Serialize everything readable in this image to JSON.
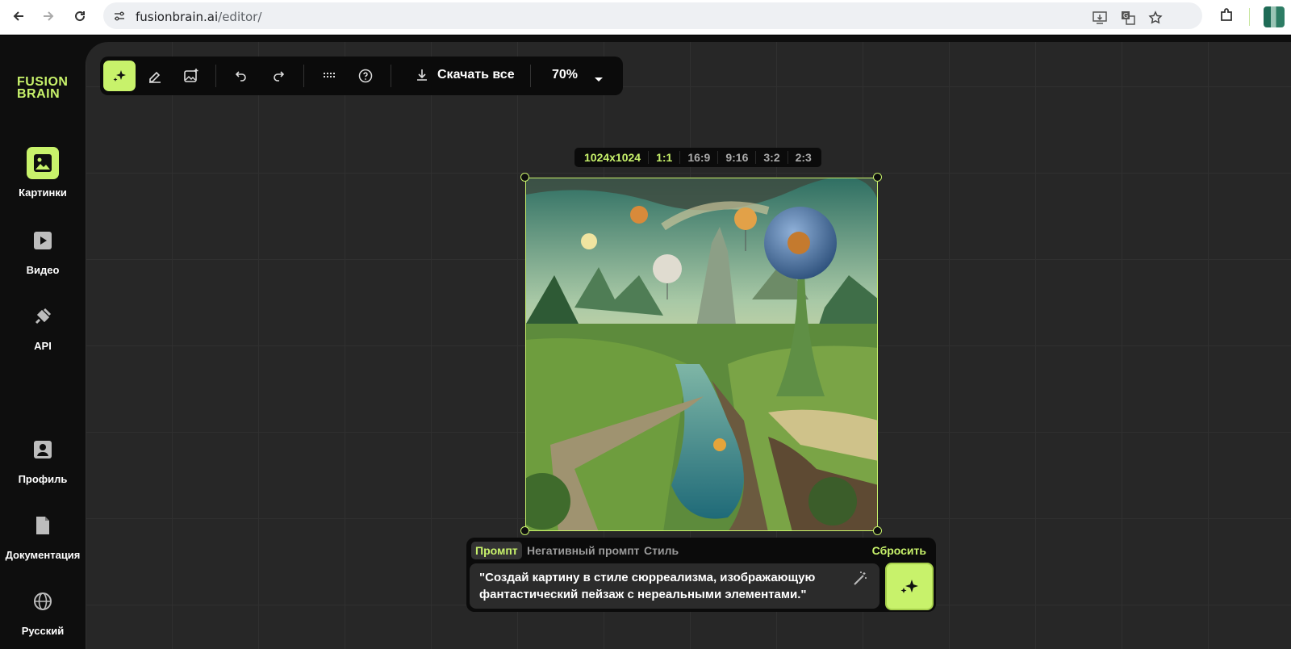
{
  "browser": {
    "url_host": "fusionbrain.ai",
    "url_path": "/editor/"
  },
  "sidebar": {
    "logo_line1": "FUSION",
    "logo_line2": "BRAIN",
    "items": [
      {
        "label": "Картинки",
        "icon": "image-icon",
        "active": true
      },
      {
        "label": "Видео",
        "icon": "video-play-icon",
        "active": false
      },
      {
        "label": "API",
        "icon": "plug-icon",
        "active": false
      },
      {
        "label": "Профиль",
        "icon": "profile-icon",
        "active": false
      },
      {
        "label": "Документация",
        "icon": "document-icon",
        "active": false
      },
      {
        "label": "Русский",
        "icon": "globe-icon",
        "active": false
      }
    ]
  },
  "toolbar": {
    "download_label": "Скачать все",
    "zoom": "70%"
  },
  "ratios": [
    "1024x1024",
    "1:1",
    "16:9",
    "9:16",
    "3:2",
    "2:3"
  ],
  "prompt_panel": {
    "tabs": [
      "Промпт",
      "Негативный промпт",
      "Стиль"
    ],
    "reset_label": "Сбросить",
    "prompt_text": "\"Создай картину в стиле сюрреализма, изображающую фантастический пейзаж с нереальными элементами.\""
  },
  "colors": {
    "accent": "#c8f26b",
    "canvas_bg": "#272727",
    "panel_bg": "#0b0b0b"
  }
}
